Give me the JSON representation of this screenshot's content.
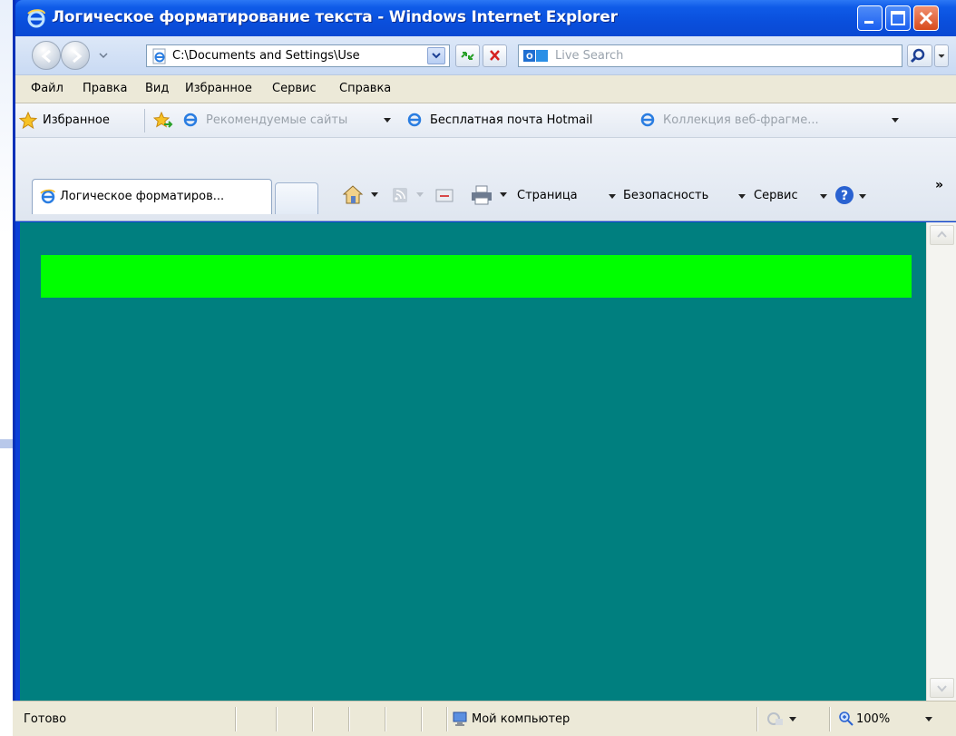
{
  "window": {
    "title": "Логическое форматирование текста - Windows Internet Explorer"
  },
  "address_bar": {
    "url": "C:\\Documents and Settings\\Use",
    "search_placeholder": "Live Search"
  },
  "menu": {
    "items": [
      "Файл",
      "Правка",
      "Вид",
      "Избранное",
      "Сервис",
      "Справка"
    ]
  },
  "favorites_bar": {
    "favorites_label": "Избранное",
    "links": [
      "Рекомендуемые сайты",
      "Бесплатная почта Hotmail",
      "Коллекция веб-фрагме..."
    ]
  },
  "tabs": {
    "active_label": "Логическое форматиров..."
  },
  "command_bar": {
    "page": "Страница",
    "safety": "Безопасность",
    "tools": "Сервис",
    "more": "»"
  },
  "page": {
    "background_color": "#007f7f",
    "bar_color": "#00ff00"
  },
  "status_bar": {
    "status": "Готово",
    "zone": "Мой компьютер",
    "zoom": "100%"
  },
  "icons": [
    "ie-logo-icon",
    "minimize-icon",
    "maximize-icon",
    "close-icon",
    "back-arrow-icon",
    "forward-arrow-icon",
    "page-icon",
    "refresh-icon",
    "stop-icon",
    "live-search-icon",
    "search-icon",
    "star-icon",
    "add-favorite-icon",
    "home-icon",
    "feeds-icon",
    "mail-icon",
    "print-icon",
    "help-icon",
    "computer-icon",
    "zoom-icon"
  ]
}
